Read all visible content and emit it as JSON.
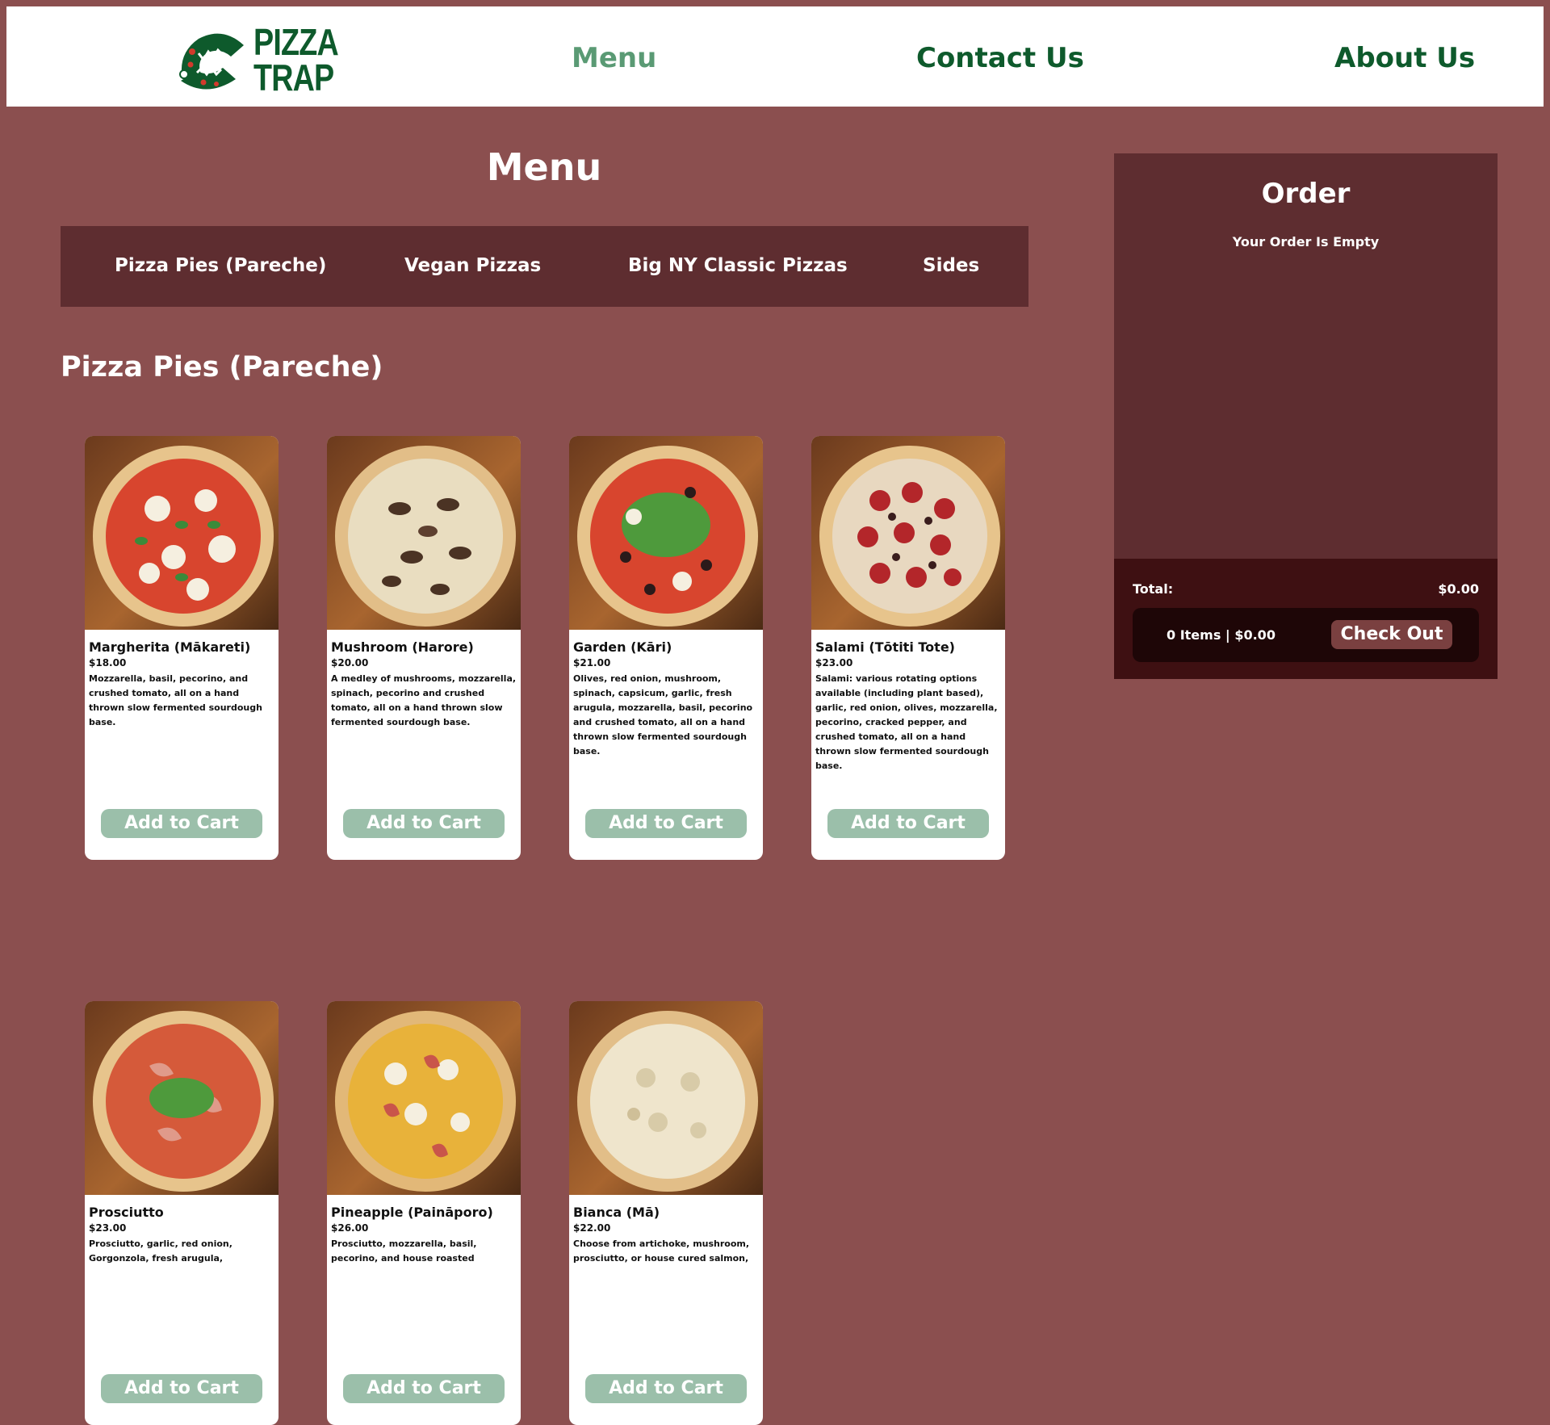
{
  "brand": {
    "logo_text_line1": "PIZZA",
    "logo_text_line2": "TRAP",
    "logo_icon": "pizza-trap-logo-icon",
    "color_primary": "#0e5a2c",
    "color_accent_muted": "#5a9a74"
  },
  "nav": {
    "menu": "Menu",
    "contact": "Contact Us",
    "about": "About Us",
    "active": "Menu"
  },
  "menu": {
    "title": "Menu",
    "tabs": [
      {
        "label": "Pizza Pies (Pareche)"
      },
      {
        "label": "Vegan Pizzas"
      },
      {
        "label": "Big NY Classic Pizzas"
      },
      {
        "label": "Sides"
      }
    ],
    "section_title": "Pizza Pies (Pareche)",
    "items": [
      {
        "name": "Margherita (Mākareti)",
        "price": "$18.00",
        "description": "Mozzarella, basil, pecorino, and crushed tomato, all on a hand thrown slow fermented sourdough base.",
        "button": "Add to Cart",
        "image": "margherita-pizza-image"
      },
      {
        "name": "Mushroom (Harore)",
        "price": "$20.00",
        "description": "A medley of mushrooms, mozzarella, spinach, pecorino and crushed tomato, all on a hand thrown slow fermented sourdough base.",
        "button": "Add to Cart",
        "image": "mushroom-pizza-image"
      },
      {
        "name": "Garden (Kāri)",
        "price": "$21.00",
        "description": "Olives, red onion, mushroom, spinach, capsicum, garlic, fresh arugula, mozzarella, basil, pecorino and crushed tomato, all on a hand thrown slow fermented sourdough base.",
        "button": "Add to Cart",
        "image": "garden-pizza-image"
      },
      {
        "name": "Salami (Tōtiti Tote)",
        "price": "$23.00",
        "description": "Salami: various rotating options available (including plant based), garlic, red onion, olives, mozzarella, pecorino, cracked pepper, and crushed tomato, all on a hand thrown slow fermented sourdough base.",
        "button": "Add to Cart",
        "image": "salami-pizza-image"
      },
      {
        "name": "Prosciutto",
        "price": "$23.00",
        "description": "Prosciutto, garlic, red onion, Gorgonzola, fresh arugula,",
        "button": "Add to Cart",
        "image": "prosciutto-pizza-image"
      },
      {
        "name": "Pineapple (Paināporo)",
        "price": "$26.00",
        "description": "Prosciutto, mozzarella, basil, pecorino, and house roasted",
        "button": "Add to Cart",
        "image": "pineapple-pizza-image"
      },
      {
        "name": "Bianca (Mā)",
        "price": "$22.00",
        "description": "Choose from artichoke, mushroom, prosciutto, or house cured salmon,",
        "button": "Add to Cart",
        "image": "bianca-pizza-image"
      }
    ]
  },
  "order": {
    "title": "Order",
    "empty_message": "Your Order Is Empty",
    "total_label": "Total:",
    "total_value": "$0.00",
    "summary": "0 Items | $0.00",
    "checkout_label": "Check Out"
  },
  "colors": {
    "page_background": "#8b4f4f",
    "panel": "#5e2d30",
    "panel_dark": "#3e1012",
    "button_disabled": "#9bbfaa"
  }
}
